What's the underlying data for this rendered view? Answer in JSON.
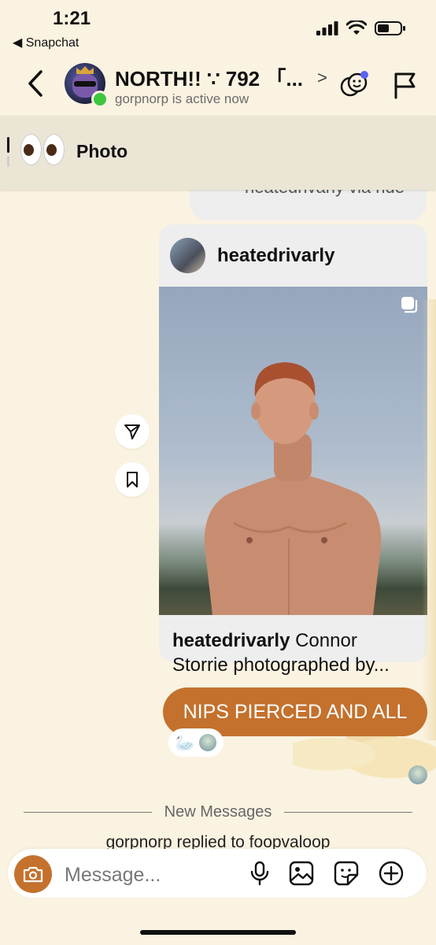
{
  "status_bar": {
    "time": "1:21",
    "back_app_label": "◀ Snapchat"
  },
  "header": {
    "chat_name": "NORTH!! ∵ 792 「...",
    "subtitle": "gorpnorp is active now",
    "chevron": ">"
  },
  "reply_banner": {
    "emoji": "👀",
    "label": "Photo"
  },
  "previous_message": {
    "text": "heatedrivarly via ride"
  },
  "shared_post": {
    "username": "heatedrivarly",
    "caption_user": "heatedrivarly",
    "caption_text": "Connor Storrie photographed by..."
  },
  "sent_message": {
    "text": "NIPS PIERCED AND ALL",
    "reaction": "🦢"
  },
  "divider": {
    "label": "New Messages"
  },
  "system_message": {
    "text": "gorpnorp replied to foopvaloop"
  },
  "composer": {
    "placeholder": "Message..."
  },
  "colors": {
    "background": "#fbf3e1",
    "accent": "#c4712d",
    "online": "#3fc63f",
    "notification_dot": "#5b63f5"
  }
}
